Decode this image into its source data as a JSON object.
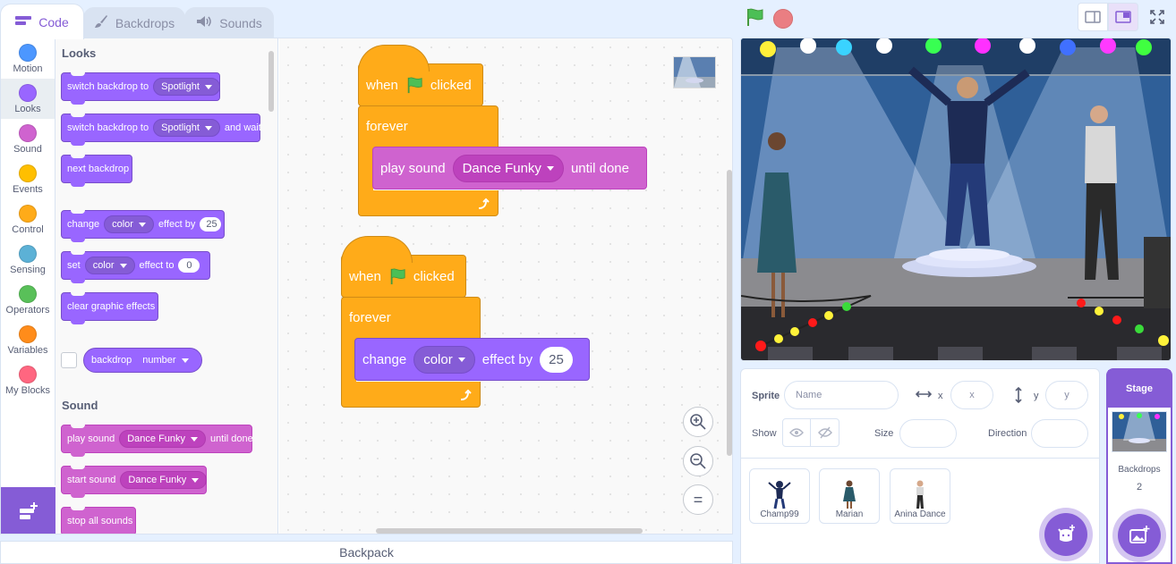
{
  "tabs": [
    {
      "label": "Code"
    },
    {
      "label": "Backdrops"
    },
    {
      "label": "Sounds"
    }
  ],
  "categories": [
    {
      "label": "Motion",
      "color": "#4c97ff"
    },
    {
      "label": "Looks",
      "color": "#9966ff"
    },
    {
      "label": "Sound",
      "color": "#cf63cf"
    },
    {
      "label": "Events",
      "color": "#ffbf00"
    },
    {
      "label": "Control",
      "color": "#ffab19"
    },
    {
      "label": "Sensing",
      "color": "#5cb1d6"
    },
    {
      "label": "Operators",
      "color": "#59c059"
    },
    {
      "label": "Variables",
      "color": "#ff8c1a"
    },
    {
      "label": "My Blocks",
      "color": "#ff6680"
    }
  ],
  "palette": {
    "looks_header": "Looks",
    "sound_header": "Sound",
    "switch_backdrop": {
      "pre": "switch backdrop to",
      "value": "Spotlight"
    },
    "switch_backdrop_wait": {
      "pre": "switch backdrop to",
      "value": "Spotlight",
      "post": "and wait"
    },
    "next_backdrop": "next backdrop",
    "change_effect": {
      "pre": "change",
      "value": "color",
      "mid": "effect by",
      "num": "25"
    },
    "set_effect": {
      "pre": "set",
      "value": "color",
      "mid": "effect to",
      "num": "0"
    },
    "clear_effects": "clear graphic effects",
    "backdrop_reporter": {
      "pre": "backdrop",
      "value": "number"
    },
    "play_sound": {
      "pre": "play sound",
      "value": "Dance Funky",
      "post": "until done"
    },
    "start_sound": {
      "pre": "start sound",
      "value": "Dance Funky"
    },
    "stop_sounds": "stop all sounds"
  },
  "scripts": {
    "script1": {
      "when": "when",
      "clicked": "clicked",
      "forever": "forever",
      "play": "play sound",
      "sound": "Dance Funky",
      "until": "until done"
    },
    "script2": {
      "when": "when",
      "clicked": "clicked",
      "forever": "forever",
      "change": "change",
      "effect": "color",
      "by": "effect by",
      "num": "25"
    }
  },
  "zoom": {
    "reset": "="
  },
  "backpack": "Backpack",
  "sprite_info": {
    "sprite_label": "Sprite",
    "name_placeholder": "Name",
    "x_label": "x",
    "x_placeholder": "x",
    "y_label": "y",
    "y_placeholder": "y",
    "show_label": "Show",
    "size_label": "Size",
    "direction_label": "Direction"
  },
  "sprites": [
    {
      "name": "Champ99"
    },
    {
      "name": "Marian"
    },
    {
      "name": "Anina Dance"
    }
  ],
  "stage_pane": {
    "title": "Stage",
    "backdrops_label": "Backdrops",
    "backdrops_count": "2"
  },
  "colors": {
    "accent": "#855cd6",
    "looks": "#9966ff",
    "sound": "#cf63cf",
    "control": "#ffab19"
  }
}
